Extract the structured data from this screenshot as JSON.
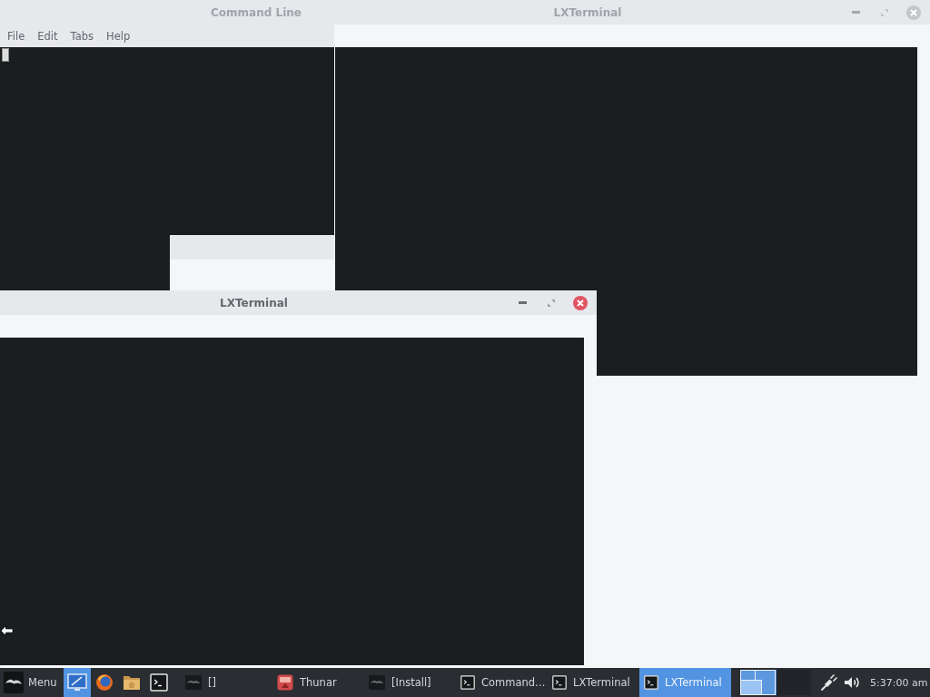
{
  "windows": [
    {
      "title": "Command Line",
      "active": false,
      "cursor": true,
      "menu": [
        "File",
        "Edit",
        "Tabs",
        "Help"
      ]
    },
    {
      "title": "LXTerminal",
      "active": false,
      "cursor": false
    },
    {
      "title": "LXTerminal",
      "active": true,
      "cursor": false
    }
  ],
  "taskbar": {
    "menu_label": "Menu",
    "launchers": [
      {
        "kind": "desktop",
        "selected": true
      },
      {
        "kind": "browser",
        "selected": false
      },
      {
        "kind": "files",
        "selected": false
      },
      {
        "kind": "terminal",
        "selected": false
      }
    ],
    "tasks": [
      {
        "kind": "app",
        "label": "[]",
        "selected": false
      },
      {
        "kind": "files",
        "label": "Thunar",
        "selected": false
      },
      {
        "kind": "app",
        "label": "[Install]",
        "selected": false
      },
      {
        "kind": "terminal",
        "label": "Command…",
        "selected": false
      },
      {
        "kind": "terminal",
        "label": "LXTerminal",
        "selected": false
      },
      {
        "kind": "terminal",
        "label": "LXTerminal",
        "selected": true
      }
    ],
    "workspaces": [
      {
        "selected": true
      },
      {
        "selected": false
      }
    ],
    "clock": "5:37:00 am"
  }
}
